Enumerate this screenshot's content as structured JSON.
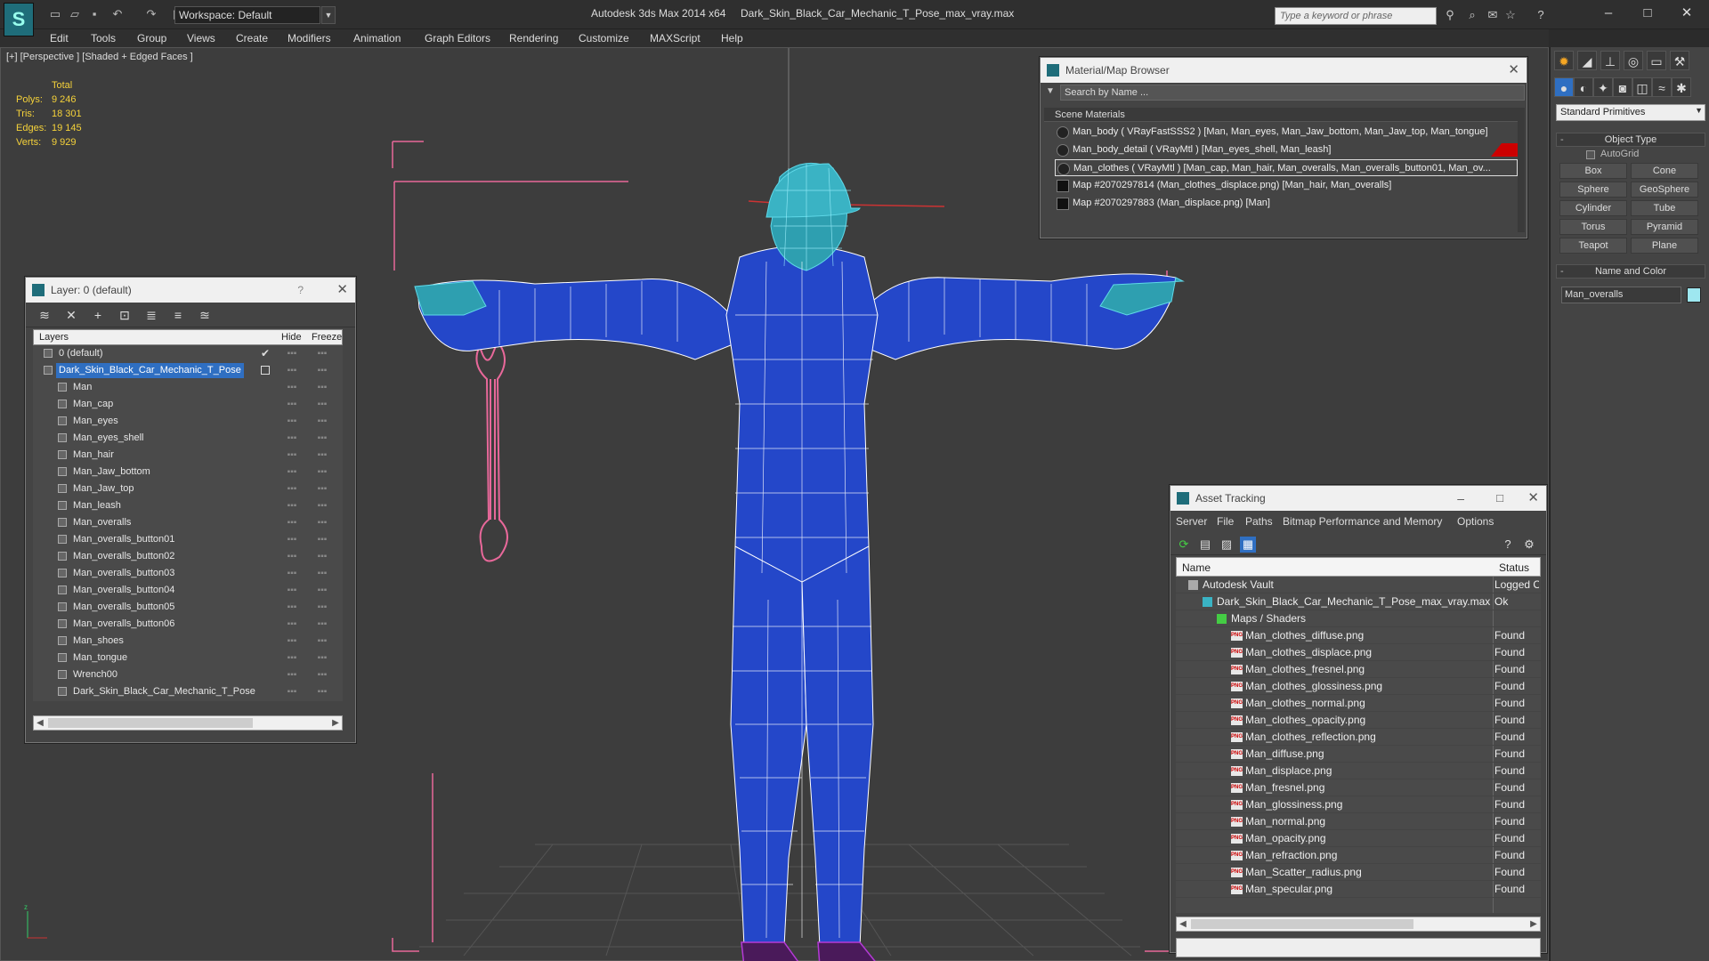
{
  "window": {
    "app_title": "Autodesk 3ds Max  2014 x64",
    "file_title": "Dark_Skin_Black_Car_Mechanic_T_Pose_max_vray.max",
    "workspace": "Workspace: Default",
    "search_placeholder": "Type a keyword or phrase"
  },
  "menu": [
    "Edit",
    "Tools",
    "Group",
    "Views",
    "Create",
    "Modifiers",
    "Animation",
    "Graph Editors",
    "Rendering",
    "Customize",
    "MAXScript",
    "Help"
  ],
  "viewport": {
    "label": "[+] [Perspective ] [Shaded + Edged Faces ]",
    "stats": {
      "header": "Total",
      "rows": [
        {
          "label": "Polys:",
          "value": "9 246"
        },
        {
          "label": "Tris:",
          "value": "18 301"
        },
        {
          "label": "Edges:",
          "value": "19 145"
        },
        {
          "label": "Verts:",
          "value": "9 929"
        }
      ]
    }
  },
  "layer_panel": {
    "title": "Layer: 0 (default)",
    "help": "?",
    "col_layers": "Layers",
    "col_hide": "Hide",
    "col_freeze": "Freeze",
    "rows": [
      {
        "name": "0 (default)",
        "level": 0,
        "checked": true
      },
      {
        "name": "Dark_Skin_Black_Car_Mechanic_T_Pose",
        "level": 0,
        "selected": true
      },
      {
        "name": "Man",
        "level": 1
      },
      {
        "name": "Man_cap",
        "level": 1
      },
      {
        "name": "Man_eyes",
        "level": 1
      },
      {
        "name": "Man_eyes_shell",
        "level": 1
      },
      {
        "name": "Man_hair",
        "level": 1
      },
      {
        "name": "Man_Jaw_bottom",
        "level": 1
      },
      {
        "name": "Man_Jaw_top",
        "level": 1
      },
      {
        "name": "Man_leash",
        "level": 1
      },
      {
        "name": "Man_overalls",
        "level": 1
      },
      {
        "name": "Man_overalls_button01",
        "level": 1
      },
      {
        "name": "Man_overalls_button02",
        "level": 1
      },
      {
        "name": "Man_overalls_button03",
        "level": 1
      },
      {
        "name": "Man_overalls_button04",
        "level": 1
      },
      {
        "name": "Man_overalls_button05",
        "level": 1
      },
      {
        "name": "Man_overalls_button06",
        "level": 1
      },
      {
        "name": "Man_shoes",
        "level": 1
      },
      {
        "name": "Man_tongue",
        "level": 1
      },
      {
        "name": "Wrench00",
        "level": 1
      },
      {
        "name": "Dark_Skin_Black_Car_Mechanic_T_Pose",
        "level": 1
      }
    ]
  },
  "material_browser": {
    "title": "Material/Map Browser",
    "search": "Search by Name ...",
    "section": "Scene Materials",
    "rows": [
      {
        "text": "Man_body  ( VRayFastSSS2 )  [Man, Man_eyes, Man_Jaw_bottom, Man_Jaw_top, Man_tongue]",
        "kind": "mat"
      },
      {
        "text": "Man_body_detail  ( VRayMtl )  [Man_eyes_shell, Man_leash]",
        "kind": "mat",
        "flag": true
      },
      {
        "text": "Man_clothes  ( VRayMtl )  [Man_cap, Man_hair, Man_overalls, Man_overalls_button01, Man_ov...",
        "kind": "mat",
        "highlight": true
      },
      {
        "text": "Map #2070297814 (Man_clothes_displace.png)  [Man_hair, Man_overalls]",
        "kind": "map"
      },
      {
        "text": "Map #2070297883 (Man_displace.png)  [Man]",
        "kind": "map"
      }
    ]
  },
  "asset_tracking": {
    "title": "Asset Tracking",
    "menu": [
      "Server",
      "File",
      "Paths",
      "Bitmap Performance and Memory",
      "Options"
    ],
    "col_name": "Name",
    "col_status": "Status",
    "rows": [
      {
        "name": "Autodesk Vault",
        "status": "Logged Out",
        "indent": 1,
        "icon": "vault"
      },
      {
        "name": "Dark_Skin_Black_Car_Mechanic_T_Pose_max_vray.max",
        "status": "Ok",
        "indent": 2,
        "icon": "max"
      },
      {
        "name": "Maps / Shaders",
        "status": "",
        "indent": 3,
        "icon": "folder"
      },
      {
        "name": "Man_clothes_diffuse.png",
        "status": "Found",
        "indent": 4,
        "icon": "png"
      },
      {
        "name": "Man_clothes_displace.png",
        "status": "Found",
        "indent": 4,
        "icon": "png"
      },
      {
        "name": "Man_clothes_fresnel.png",
        "status": "Found",
        "indent": 4,
        "icon": "png"
      },
      {
        "name": "Man_clothes_glossiness.png",
        "status": "Found",
        "indent": 4,
        "icon": "png"
      },
      {
        "name": "Man_clothes_normal.png",
        "status": "Found",
        "indent": 4,
        "icon": "png"
      },
      {
        "name": "Man_clothes_opacity.png",
        "status": "Found",
        "indent": 4,
        "icon": "png"
      },
      {
        "name": "Man_clothes_reflection.png",
        "status": "Found",
        "indent": 4,
        "icon": "png"
      },
      {
        "name": "Man_diffuse.png",
        "status": "Found",
        "indent": 4,
        "icon": "png"
      },
      {
        "name": "Man_displace.png",
        "status": "Found",
        "indent": 4,
        "icon": "png"
      },
      {
        "name": "Man_fresnel.png",
        "status": "Found",
        "indent": 4,
        "icon": "png"
      },
      {
        "name": "Man_glossiness.png",
        "status": "Found",
        "indent": 4,
        "icon": "png"
      },
      {
        "name": "Man_normal.png",
        "status": "Found",
        "indent": 4,
        "icon": "png"
      },
      {
        "name": "Man_opacity.png",
        "status": "Found",
        "indent": 4,
        "icon": "png"
      },
      {
        "name": "Man_refraction.png",
        "status": "Found",
        "indent": 4,
        "icon": "png"
      },
      {
        "name": "Man_Scatter_radius.png",
        "status": "Found",
        "indent": 4,
        "icon": "png"
      },
      {
        "name": "Man_specular.png",
        "status": "Found",
        "indent": 4,
        "icon": "png"
      }
    ]
  },
  "command_panel": {
    "dropdown": "Standard Primitives",
    "object_type": "Object Type",
    "autogrid": "AutoGrid",
    "buttons": [
      "Box",
      "Cone",
      "Sphere",
      "GeoSphere",
      "Cylinder",
      "Tube",
      "Torus",
      "Pyramid",
      "Teapot",
      "Plane"
    ],
    "name_color": "Name and Color",
    "object_name": "Man_overalls",
    "object_color": "#9ee7f0"
  },
  "colors": {
    "selection": "#2f6fc2",
    "overalls": "#2447c9",
    "wire": "#ffffff",
    "skin_wire": "#5fd8e8",
    "wrench": "#e8689a",
    "shoes": "#b43ad6",
    "stats": "#f5d23a"
  }
}
